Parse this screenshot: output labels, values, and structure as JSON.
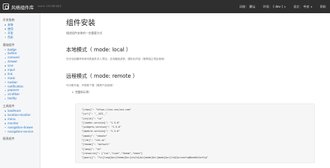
{
  "topbar": {
    "brand": "风格组件库",
    "build": "build: 2023年3月3",
    "style_label": "风格：",
    "style_value": "默认",
    "env_label": "环境：",
    "env_value": "[ dev ]",
    "lang_label": "语言：",
    "lang_value": "中文",
    "help": "帮助"
  },
  "sidebar": {
    "groups": [
      {
        "title": "开发指南",
        "items": [
          "安装",
          "使用",
          "开发",
          "色彩"
        ]
      },
      {
        "title": "基础组件",
        "items": [
          "badge",
          "button",
          "carousel",
          "drawer",
          "icon",
          "input",
          "link",
          "mask",
          "navbar",
          "notification",
          "popover",
          "scrollbar",
          "tooltip"
        ]
      },
      {
        "title": "工具组件",
        "items": [
          "loadmore",
          "location-monitor",
          "menu",
          "monitor",
          "navigation-drawer",
          "navigation-service"
        ]
      },
      {
        "title": "图表组件",
        "items": []
      }
    ]
  },
  "main": {
    "title": "组件安装",
    "description": "描述组件安装的一些重要方式",
    "local_heading": "本地模式（ mode: local ）",
    "local_text": "在仓包括模块有用列类组件并入项目，支持播放皮肤，国际化内容（推荐独立项目使用）",
    "remote_heading": "远程模式（ mode: remote ）",
    "remote_text": "可分散升级，开按新下载（推荐产品使用）",
    "step1": "1.  完整如示例：",
    "code_lines": [
      "\"[repo]\": \"https://xxx.xxx/xxx.com\"",
      "\"[url]\": \"__XX3__\"",
      "\"[style]\": \"ui\"",
      "\"[loader-version]\": \"1.5.0\"",
      "\"[widgets-version]\": \"1.5.0\"",
      "\"[module-version]\": \"1.5.0\"",
      "\"[mode]\": \"remote\"",
      "\"[lib]\": \"lib-ui\"",
      "\"[theme]\": \"default\"",
      "\"[lang]\": \"zh\"",
      "\"[resource]\": [\"iui\",\"icon\",\"theme\",\"base\"]",
      "\"[query]\": \"?v=[lang]&v=[theme]&v=[style]&v=[mode]&t=[mode]&v=[lib]&v=configBaseOnConfig\""
    ]
  }
}
